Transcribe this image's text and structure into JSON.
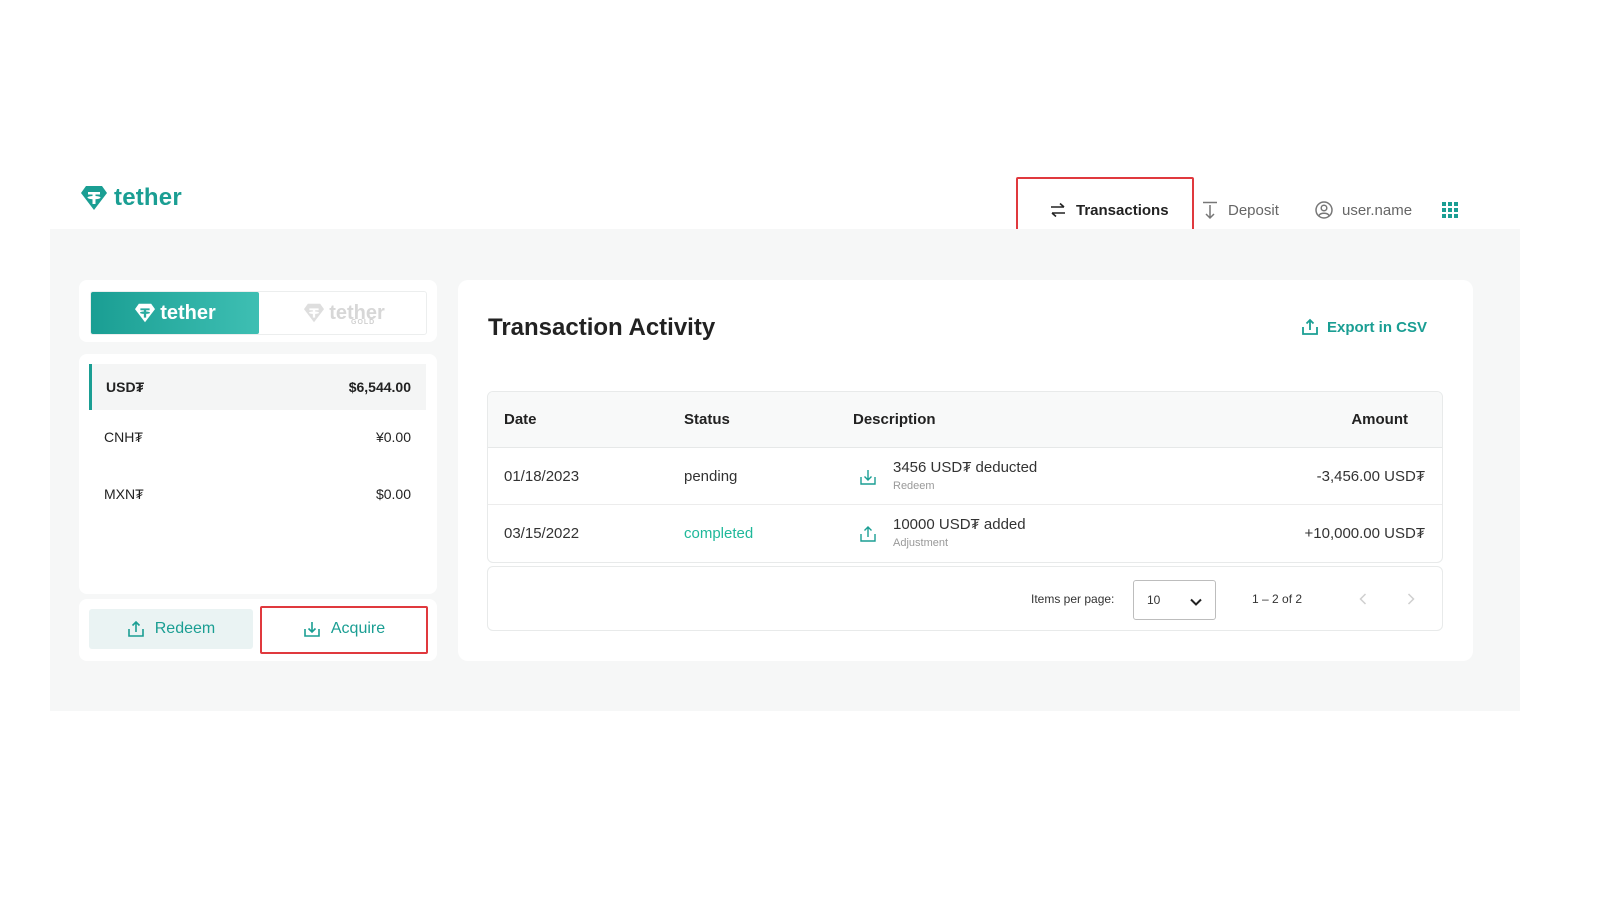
{
  "header": {
    "logo_text": "tether",
    "nav": {
      "transactions": "Transactions",
      "deposit": "Deposit",
      "user": "user.name"
    }
  },
  "brand_switch": {
    "active": "tether",
    "inactive": "tether",
    "inactive_sub": "GOLD"
  },
  "balances": [
    {
      "currency": "USD₮",
      "amount": "$6,544.00"
    },
    {
      "currency": "CNH₮",
      "amount": "¥0.00"
    },
    {
      "currency": "MXN₮",
      "amount": "$0.00"
    }
  ],
  "actions": {
    "redeem": "Redeem",
    "acquire": "Acquire"
  },
  "activity": {
    "title": "Transaction Activity",
    "export_label": "Export in CSV",
    "columns": {
      "date": "Date",
      "status": "Status",
      "description": "Description",
      "amount": "Amount"
    },
    "rows": [
      {
        "date": "01/18/2023",
        "status": "pending",
        "description": "3456 USD₮ deducted",
        "type": "Redeem",
        "amount": "-3,456.00 USD₮",
        "icon": "download-icon"
      },
      {
        "date": "03/15/2022",
        "status": "completed",
        "description": "10000 USD₮ added",
        "type": "Adjustment",
        "amount": "+10,000.00 USD₮",
        "icon": "upload-icon"
      }
    ],
    "paginator": {
      "items_per_page_label": "Items per page:",
      "items_per_page": "10",
      "range": "1 – 2 of 2"
    }
  },
  "colors": {
    "accent": "#1a9e93",
    "highlight": "#e0393e",
    "completed": "#1fb89a"
  }
}
